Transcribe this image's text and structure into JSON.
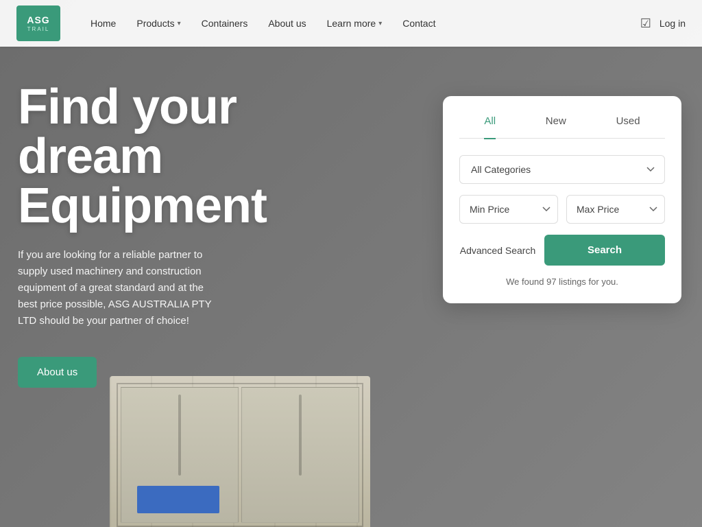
{
  "nav": {
    "logo_line1": "ASG",
    "logo_line2": "TRAIL",
    "links": [
      {
        "label": "Home",
        "has_dropdown": false
      },
      {
        "label": "Products",
        "has_dropdown": true
      },
      {
        "label": "Containers",
        "has_dropdown": false
      },
      {
        "label": "About us",
        "has_dropdown": false
      },
      {
        "label": "Learn more",
        "has_dropdown": true
      },
      {
        "label": "Contact",
        "has_dropdown": false
      }
    ],
    "login_label": "Log in"
  },
  "hero": {
    "title_line1": "Find your",
    "title_line2": "dream",
    "title_line3": "Equipment",
    "subtitle": "If you are looking for a reliable partner to supply used machinery and construction equipment of a great standard and at the best price possible, ASG AUSTRALIA PTY LTD should be your partner of choice!",
    "about_button": "About us"
  },
  "search_card": {
    "tabs": [
      {
        "label": "All",
        "active": true
      },
      {
        "label": "New",
        "active": false
      },
      {
        "label": "Used",
        "active": false
      }
    ],
    "category_placeholder": "All Categories",
    "min_price_placeholder": "Min Price",
    "max_price_placeholder": "Max Price",
    "advanced_search_label": "Advanced Search",
    "search_button_label": "Search",
    "results_text": "We found 97 listings for you."
  }
}
